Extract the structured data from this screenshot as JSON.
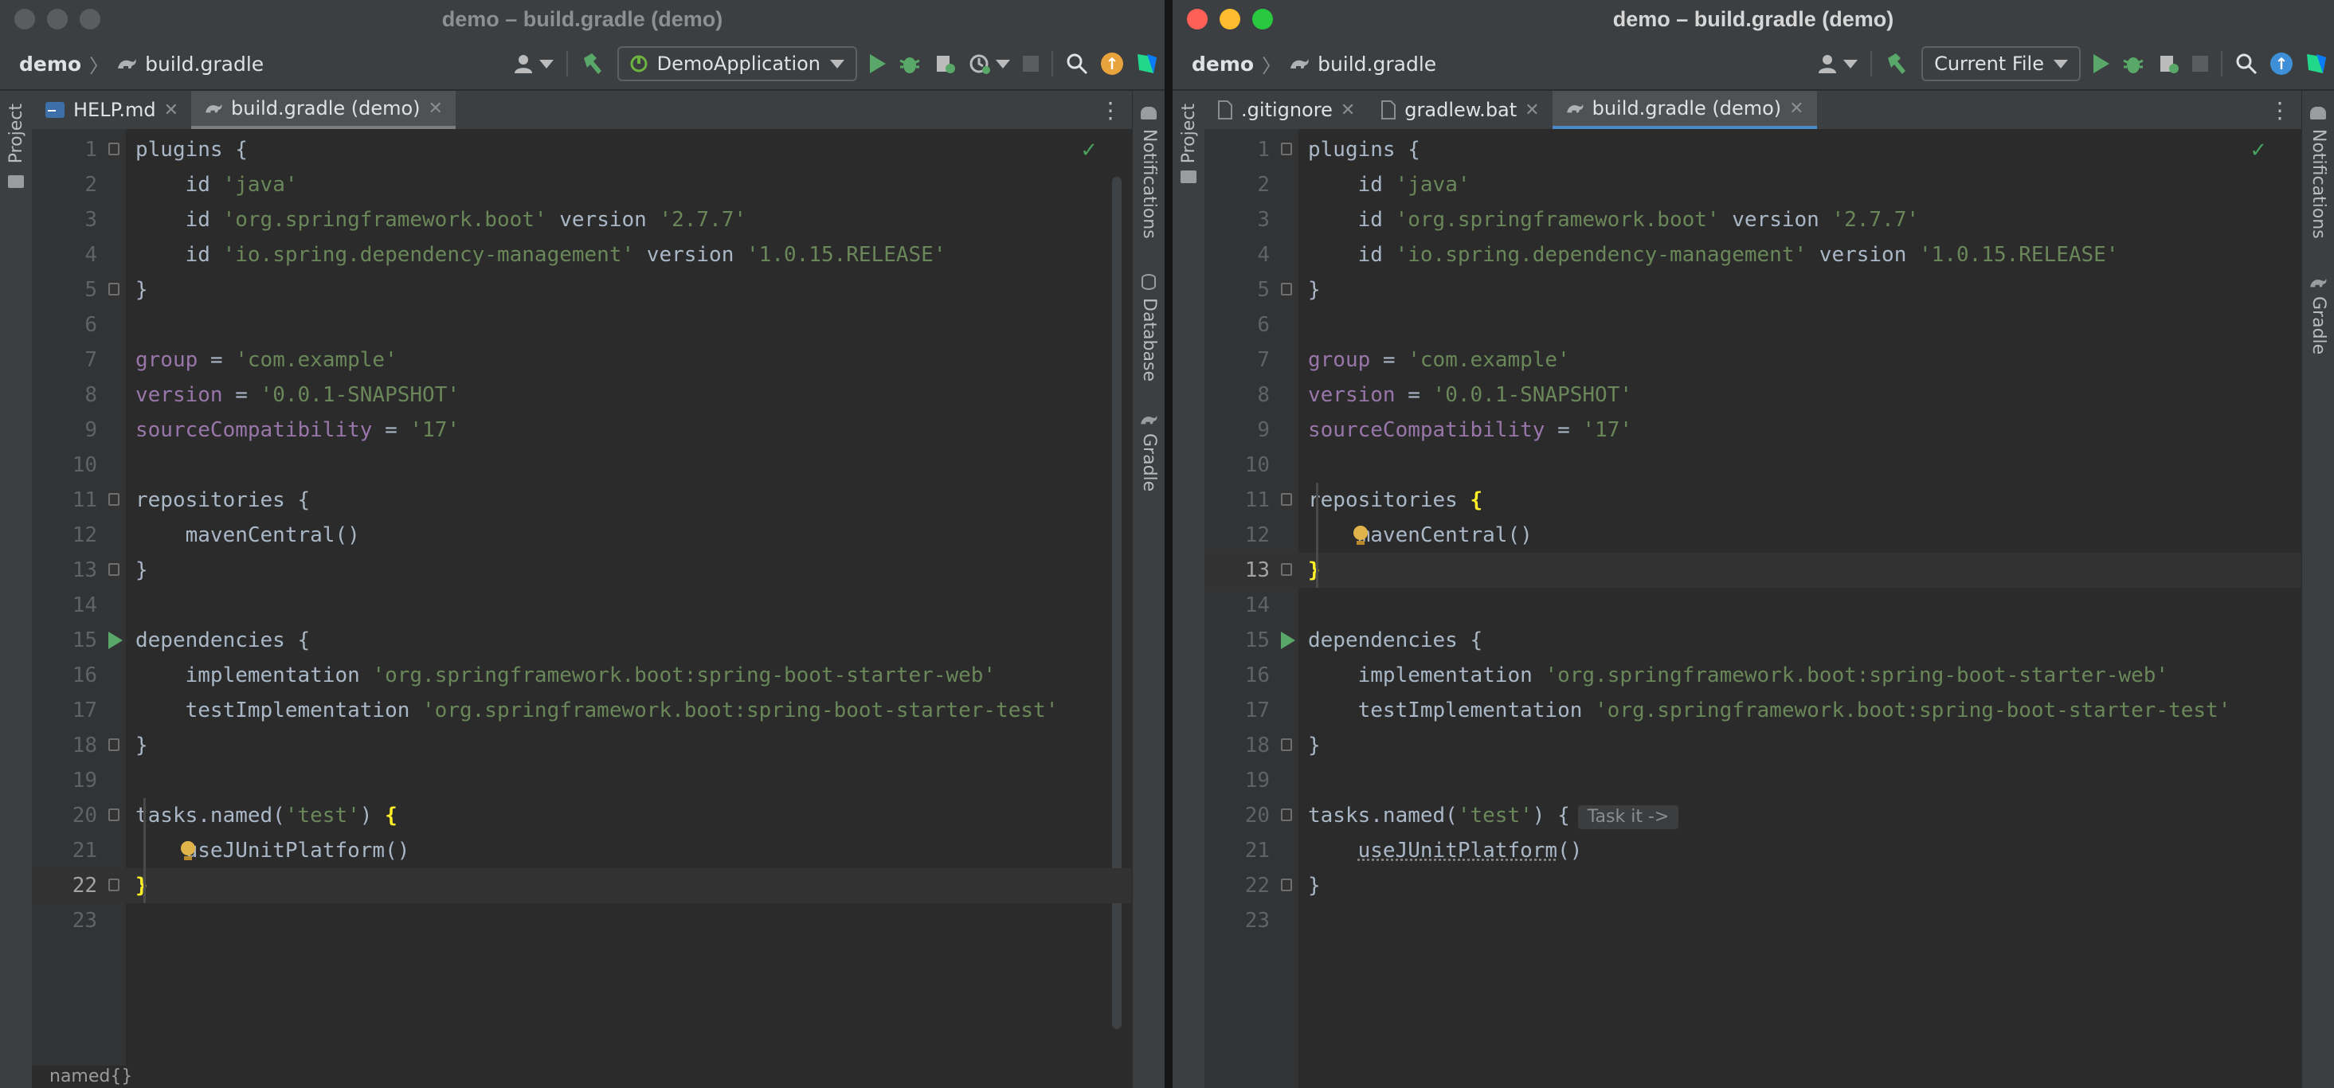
{
  "left": {
    "title": "demo – build.gradle (demo)",
    "breadcrumb": {
      "project": "demo",
      "file": "build.gradle"
    },
    "run_config": "DemoApplication",
    "tabs": [
      {
        "label": "HELP.md",
        "icon": "markdown-icon"
      },
      {
        "label": "build.gradle (demo)",
        "icon": "gradle-icon",
        "active": true
      }
    ],
    "sidebar_left": {
      "project": "Project"
    },
    "sidebar_right": {
      "notifications": "Notifications",
      "database": "Database",
      "gradle": "Gradle"
    },
    "status_text": "named{}",
    "current_line": 22
  },
  "right": {
    "title": "demo – build.gradle (demo)",
    "breadcrumb": {
      "project": "demo",
      "file": "build.gradle"
    },
    "run_config": "Current File",
    "tabs": [
      {
        "label": ".gitignore",
        "icon": "gitignore-icon"
      },
      {
        "label": "gradlew.bat",
        "icon": "file-icon"
      },
      {
        "label": "build.gradle (demo)",
        "icon": "gradle-icon",
        "active": true
      }
    ],
    "sidebar_left": {
      "project": "Project"
    },
    "sidebar_right": {
      "notifications": "Notifications",
      "gradle": "Gradle"
    },
    "inlay_hint": "Task it ->",
    "current_line": 13
  },
  "code_lines": [
    "plugins {",
    "    id 'java'",
    "    id 'org.springframework.boot' version '2.7.7'",
    "    id 'io.spring.dependency-management' version '1.0.15.RELEASE'",
    "}",
    "",
    "group = 'com.example'",
    "version = '0.0.1-SNAPSHOT'",
    "sourceCompatibility = '17'",
    "",
    "repositories {",
    "    mavenCentral()",
    "}",
    "",
    "dependencies {",
    "    implementation 'org.springframework.boot:spring-boot-starter-web'",
    "    testImplementation 'org.springframework.boot:spring-boot-starter-test'",
    "}",
    "",
    "tasks.named('test') {",
    "    useJUnitPlatform()",
    "}",
    ""
  ],
  "colors": {
    "accent": "#4a88c7",
    "run": "#59a869",
    "string": "#6a8759",
    "property": "#9876aa",
    "text": "#a9b7c6"
  }
}
